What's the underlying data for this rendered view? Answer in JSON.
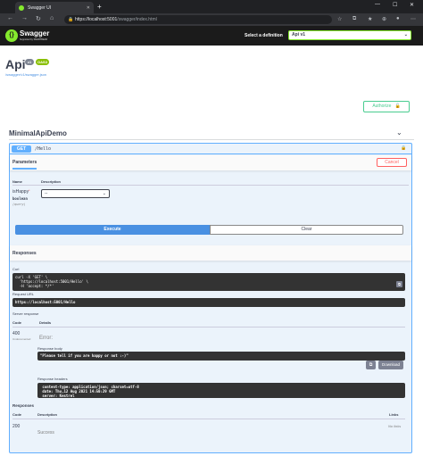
{
  "browser": {
    "tab_title": "Swagger UI",
    "address_host": "https://localhost:5001",
    "address_path": "/swagger/index.html",
    "colors": {
      "chrome_dark": "#202124",
      "chrome_mid": "#35363a"
    }
  },
  "topbar": {
    "brand": "Swagger",
    "brand_sub": "Supported by SMARTBEAR",
    "select_label": "Select a definition",
    "selected_definition": "Api v1",
    "colors": {
      "background": "#1b1b1b",
      "accent": "#85ea2d"
    }
  },
  "info": {
    "title": "Api",
    "version_badge": "v1",
    "oas_badge": "OAS3",
    "json_link": "/swagger/v1/swagger.json",
    "authorize_label": "Authorize"
  },
  "tag": {
    "name": "MinimalApiDemo"
  },
  "operation": {
    "method": "GET",
    "path": "/Hello",
    "colors": {
      "method": "#61affe",
      "background": "#ebf3fb"
    },
    "parameters_title": "Parameters",
    "cancel_label": "Cancel",
    "param_columns": {
      "name": "Name",
      "description": "Description"
    },
    "param": {
      "name": "isHappy",
      "required_mark": "*",
      "type": "boolean",
      "in": "(query)",
      "selected_value": "--"
    },
    "execute_label": "Execute",
    "clear_label": "Clear"
  },
  "responses_live": {
    "title": "Responses",
    "curl_label": "Curl",
    "curl_text": "curl -X 'GET' \\\n  'https://localhost:5001/Hello' \\\n  -H 'accept: */*'",
    "request_url_label": "Request URL",
    "request_url": "https://localhost:5001/Hello",
    "server_response_label": "Server response",
    "col_code": "Code",
    "col_details": "Details",
    "code": "400",
    "code_note": "Undocumented",
    "error_label": "Error:",
    "body_label": "Response body",
    "body_text": "\"Please tell if you are happy or not :-)\"",
    "download_label": "Download",
    "headers_label": "Response headers",
    "headers_text": " content-type: application/json; charset=utf-8\n date: Thu,12 Aug 2021 14:50:29 GMT\n server: Kestrel"
  },
  "responses_doc": {
    "title": "Responses",
    "col_code": "Code",
    "col_description": "Description",
    "col_links": "Links",
    "code": "200",
    "description": "Success",
    "links": "No links"
  }
}
